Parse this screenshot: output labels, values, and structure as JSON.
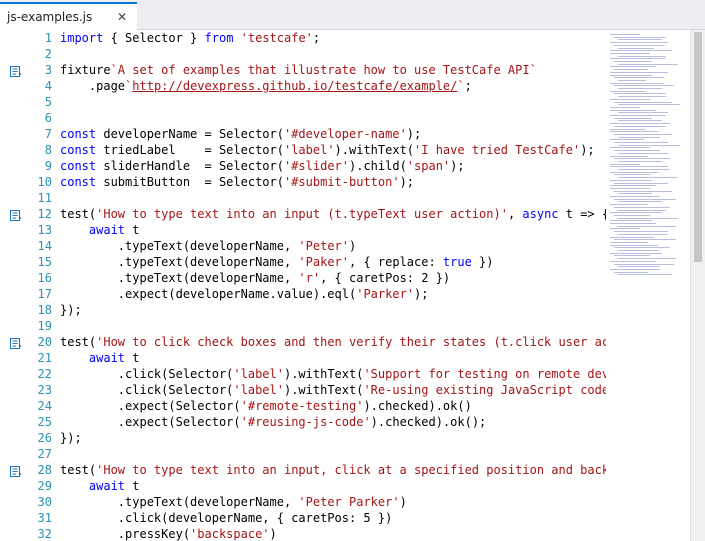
{
  "tab": {
    "title": "js-examples.js",
    "close_glyph": "✕"
  },
  "colors": {
    "keyword": "#0000ff",
    "string": "#a31515",
    "line_number": "#2b91af",
    "accent": "#007acc"
  },
  "icons": {
    "codelens": "codelens-icon",
    "close": "close-icon"
  },
  "lines": [
    {
      "n": "1",
      "marker": false,
      "tokens": [
        [
          "kw",
          "import"
        ],
        [
          "p",
          " { Selector } "
        ],
        [
          "kw",
          "from"
        ],
        [
          "p",
          " "
        ],
        [
          "str",
          "'testcafe'"
        ],
        [
          "p",
          ";"
        ]
      ]
    },
    {
      "n": "2",
      "marker": false,
      "tokens": []
    },
    {
      "n": "3",
      "marker": true,
      "tokens": [
        [
          "p",
          "fixture"
        ],
        [
          "str",
          "`A set of examples that illustrate how to use TestCafe API`"
        ]
      ]
    },
    {
      "n": "4",
      "marker": false,
      "tokens": [
        [
          "p",
          "    .page"
        ],
        [
          "str",
          "`"
        ],
        [
          "url",
          "http://devexpress.github.io/testcafe/example/"
        ],
        [
          "str",
          "`"
        ],
        [
          "p",
          ";"
        ]
      ]
    },
    {
      "n": "5",
      "marker": false,
      "tokens": []
    },
    {
      "n": "6",
      "marker": false,
      "tokens": []
    },
    {
      "n": "7",
      "marker": false,
      "tokens": [
        [
          "kw",
          "const"
        ],
        [
          "p",
          " developerName = Selector("
        ],
        [
          "str",
          "'#developer-name'"
        ],
        [
          "p",
          ");"
        ]
      ]
    },
    {
      "n": "8",
      "marker": false,
      "tokens": [
        [
          "kw",
          "const"
        ],
        [
          "p",
          " triedLabel    = Selector("
        ],
        [
          "str",
          "'label'"
        ],
        [
          "p",
          ").withText("
        ],
        [
          "str",
          "'I have tried TestCafe'"
        ],
        [
          "p",
          ");"
        ]
      ]
    },
    {
      "n": "9",
      "marker": false,
      "tokens": [
        [
          "kw",
          "const"
        ],
        [
          "p",
          " sliderHandle  = Selector("
        ],
        [
          "str",
          "'#slider'"
        ],
        [
          "p",
          ").child("
        ],
        [
          "str",
          "'span'"
        ],
        [
          "p",
          ");"
        ]
      ]
    },
    {
      "n": "10",
      "marker": false,
      "tokens": [
        [
          "kw",
          "const"
        ],
        [
          "p",
          " submitButton  = Selector("
        ],
        [
          "str",
          "'#submit-button'"
        ],
        [
          "p",
          ");"
        ]
      ]
    },
    {
      "n": "11",
      "marker": false,
      "tokens": []
    },
    {
      "n": "12",
      "marker": true,
      "tokens": [
        [
          "p",
          "test("
        ],
        [
          "str",
          "'How to type text into an input (t.typeText user action)'"
        ],
        [
          "p",
          ", "
        ],
        [
          "kw",
          "async"
        ],
        [
          "p",
          " t => {"
        ]
      ]
    },
    {
      "n": "13",
      "marker": false,
      "tokens": [
        [
          "p",
          "    "
        ],
        [
          "kw",
          "await"
        ],
        [
          "p",
          " t"
        ]
      ]
    },
    {
      "n": "14",
      "marker": false,
      "tokens": [
        [
          "p",
          "        .typeText(developerName, "
        ],
        [
          "str",
          "'Peter'"
        ],
        [
          "p",
          ")"
        ]
      ]
    },
    {
      "n": "15",
      "marker": false,
      "tokens": [
        [
          "p",
          "        .typeText(developerName, "
        ],
        [
          "str",
          "'Paker'"
        ],
        [
          "p",
          ", { replace: "
        ],
        [
          "kw",
          "true"
        ],
        [
          "p",
          " })"
        ]
      ]
    },
    {
      "n": "16",
      "marker": false,
      "tokens": [
        [
          "p",
          "        .typeText(developerName, "
        ],
        [
          "str",
          "'r'"
        ],
        [
          "p",
          ", { caretPos: 2 })"
        ]
      ]
    },
    {
      "n": "17",
      "marker": false,
      "tokens": [
        [
          "p",
          "        .expect(developerName.value).eql("
        ],
        [
          "str",
          "'Parker'"
        ],
        [
          "p",
          ");"
        ]
      ]
    },
    {
      "n": "18",
      "marker": false,
      "tokens": [
        [
          "p",
          "});"
        ]
      ]
    },
    {
      "n": "19",
      "marker": false,
      "tokens": []
    },
    {
      "n": "20",
      "marker": true,
      "tokens": [
        [
          "p",
          "test("
        ],
        [
          "str",
          "'How to click check boxes and then verify their states (t.click user action an"
        ]
      ]
    },
    {
      "n": "21",
      "marker": false,
      "tokens": [
        [
          "p",
          "    "
        ],
        [
          "kw",
          "await"
        ],
        [
          "p",
          " t"
        ]
      ]
    },
    {
      "n": "22",
      "marker": false,
      "tokens": [
        [
          "p",
          "        .click(Selector("
        ],
        [
          "str",
          "'label'"
        ],
        [
          "p",
          ").withText("
        ],
        [
          "str",
          "'Support for testing on remote devices'"
        ],
        [
          "p",
          "))"
        ]
      ]
    },
    {
      "n": "23",
      "marker": false,
      "tokens": [
        [
          "p",
          "        .click(Selector("
        ],
        [
          "str",
          "'label'"
        ],
        [
          "p",
          ").withText("
        ],
        [
          "str",
          "'Re-using existing JavaScript code for te"
        ]
      ]
    },
    {
      "n": "24",
      "marker": false,
      "tokens": [
        [
          "p",
          "        .expect(Selector("
        ],
        [
          "str",
          "'#remote-testing'"
        ],
        [
          "p",
          ").checked).ok()"
        ]
      ]
    },
    {
      "n": "25",
      "marker": false,
      "tokens": [
        [
          "p",
          "        .expect(Selector("
        ],
        [
          "str",
          "'#reusing-js-code'"
        ],
        [
          "p",
          ").checked).ok();"
        ]
      ]
    },
    {
      "n": "26",
      "marker": false,
      "tokens": [
        [
          "p",
          "});"
        ]
      ]
    },
    {
      "n": "27",
      "marker": false,
      "tokens": []
    },
    {
      "n": "28",
      "marker": true,
      "tokens": [
        [
          "p",
          "test("
        ],
        [
          "str",
          "'How to type text into an input, click at a specified position and backspace a"
        ]
      ]
    },
    {
      "n": "29",
      "marker": false,
      "tokens": [
        [
          "p",
          "    "
        ],
        [
          "kw",
          "await"
        ],
        [
          "p",
          " t"
        ]
      ]
    },
    {
      "n": "30",
      "marker": false,
      "tokens": [
        [
          "p",
          "        .typeText(developerName, "
        ],
        [
          "str",
          "'Peter Parker'"
        ],
        [
          "p",
          ")"
        ]
      ]
    },
    {
      "n": "31",
      "marker": false,
      "tokens": [
        [
          "p",
          "        .click(developerName, { caretPos: 5 })"
        ]
      ]
    },
    {
      "n": "32",
      "marker": false,
      "tokens": [
        [
          "p",
          "        .pressKey("
        ],
        [
          "str",
          "'backspace'"
        ],
        [
          "p",
          ")"
        ]
      ]
    }
  ]
}
